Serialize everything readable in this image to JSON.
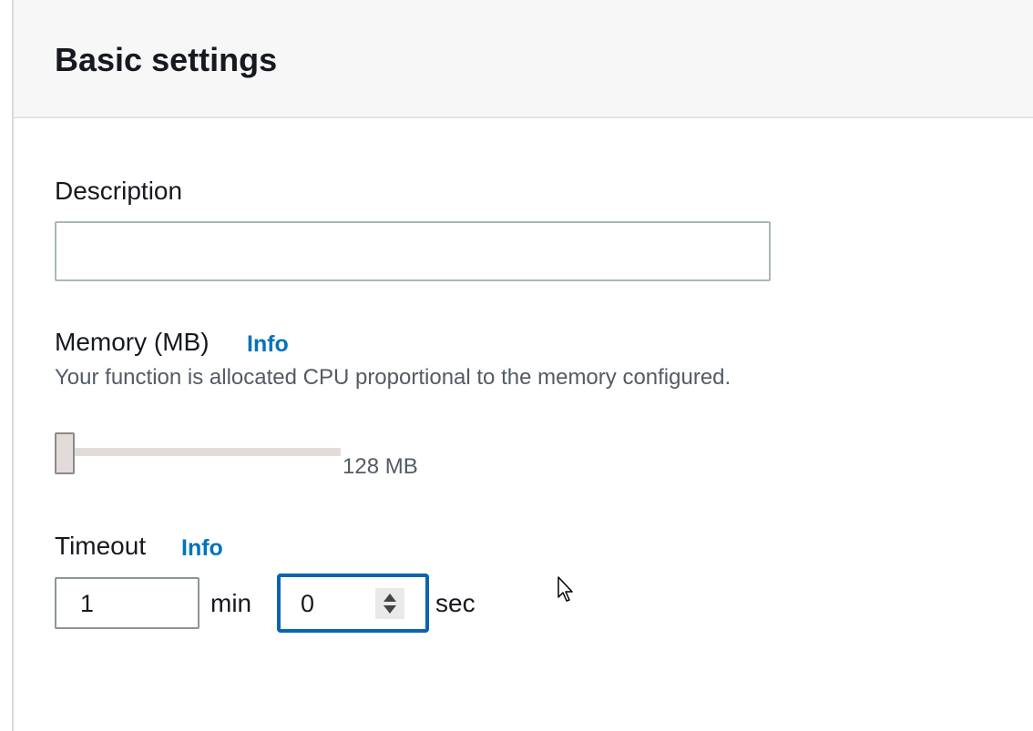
{
  "panel": {
    "title": "Basic settings"
  },
  "description": {
    "label": "Description",
    "value": "",
    "placeholder": ""
  },
  "memory": {
    "label": "Memory (MB)",
    "info_label": "Info",
    "help_text": "Your function is allocated CPU proportional to the memory configured.",
    "value_text": "128 MB",
    "slider_fraction": 0.0
  },
  "timeout": {
    "label": "Timeout",
    "info_label": "Info",
    "minutes_value": "1",
    "minutes_unit": "min",
    "seconds_value": "0",
    "seconds_unit": "sec"
  },
  "icons": {
    "spinner": "spinner-arrows-icon",
    "cursor": "mouse-pointer-icon"
  },
  "colors": {
    "info_link": "#0073bb",
    "focus_border": "#0a64b4"
  }
}
